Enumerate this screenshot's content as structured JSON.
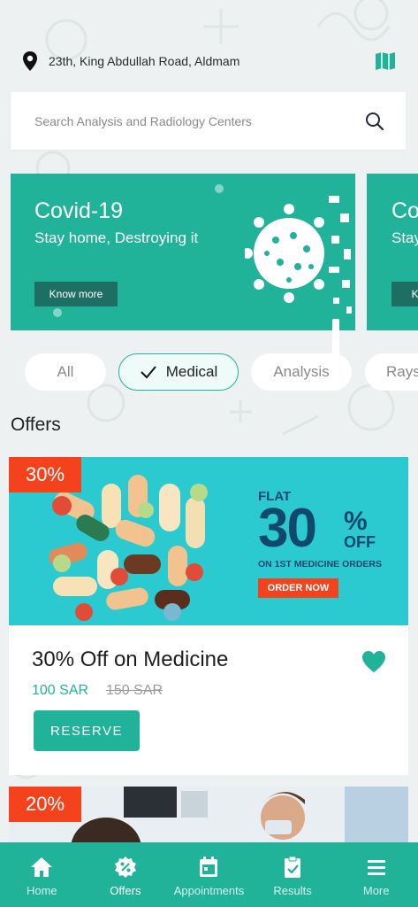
{
  "location": {
    "address": "23th, King Abdullah Road, Aldmam",
    "pin_icon": "location-pin-icon",
    "map_icon": "map-icon"
  },
  "search": {
    "placeholder": "Search Analysis and Radiology Centers",
    "icon": "search-icon"
  },
  "banners": [
    {
      "title": "Covid-19",
      "subtitle": "Stay home, Destroying it",
      "button": "Know more"
    },
    {
      "title": "Co",
      "subtitle": "Stay",
      "button": "Kn"
    }
  ],
  "categories": [
    {
      "label": "All",
      "active": false
    },
    {
      "label": "Medical",
      "active": true
    },
    {
      "label": "Analysis",
      "active": false
    },
    {
      "label": "Rays",
      "active": false
    }
  ],
  "offers": {
    "title": "Offers",
    "items": [
      {
        "badge": "30%",
        "name": "30% Off on Medicine",
        "price": "100 SAR",
        "old_price": "150 SAR",
        "reserve_label": "RESERVE",
        "promo": {
          "flat": "FLAT",
          "big": "30",
          "percent": "%",
          "off": "OFF",
          "line": "ON 1ST MEDICINE ORDERS",
          "order": "ORDER NOW"
        }
      },
      {
        "badge": "20%"
      }
    ]
  },
  "nav": [
    {
      "label": "Home",
      "icon": "home-icon"
    },
    {
      "label": "Offers",
      "icon": "offers-icon"
    },
    {
      "label": "Appointments",
      "icon": "calendar-icon"
    },
    {
      "label": "Results",
      "icon": "clipboard-icon"
    },
    {
      "label": "More",
      "icon": "menu-icon"
    }
  ],
  "colors": {
    "primary": "#20b39a",
    "badge": "#f4431c",
    "background": "#eef1f1"
  }
}
